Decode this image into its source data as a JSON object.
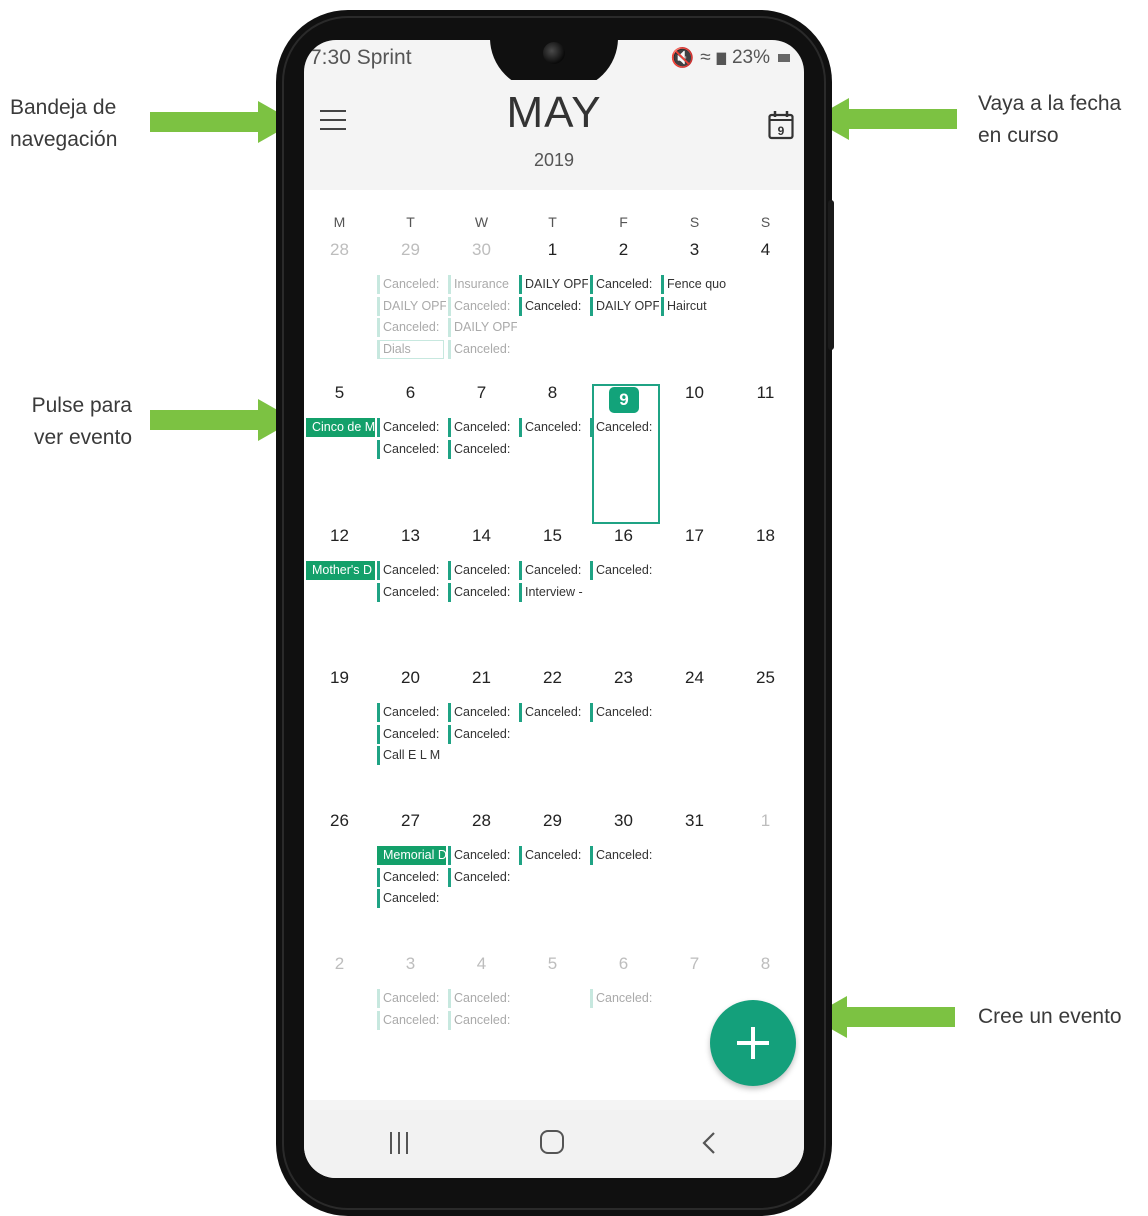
{
  "callouts": {
    "nav_drawer": [
      "Bandeja de",
      "navegación"
    ],
    "go_today": [
      "Vaya a la fecha",
      "en curso"
    ],
    "tap_event": [
      "Pulse para",
      "ver evento"
    ],
    "create_event": "Cree un evento"
  },
  "status": {
    "time_carrier": "7:30 Sprint",
    "battery": "23%"
  },
  "header": {
    "month": "MAY",
    "year": "2019",
    "today_icon_day": "9"
  },
  "weekdays": [
    "M",
    "T",
    "W",
    "T",
    "F",
    "S",
    "S"
  ],
  "weeks": [
    {
      "days": [
        "28",
        "29",
        "30",
        "1",
        "2",
        "3",
        "4"
      ]
    },
    {
      "days": [
        "5",
        "6",
        "7",
        "8",
        "9",
        "10",
        "11"
      ]
    },
    {
      "days": [
        "12",
        "13",
        "14",
        "15",
        "16",
        "17",
        "18"
      ]
    },
    {
      "days": [
        "19",
        "20",
        "21",
        "22",
        "23",
        "24",
        "25"
      ]
    },
    {
      "days": [
        "26",
        "27",
        "28",
        "29",
        "30",
        "31",
        "1"
      ]
    },
    {
      "days": [
        "2",
        "3",
        "4",
        "5",
        "6",
        "7",
        "8"
      ]
    }
  ],
  "events": {
    "w1": {
      "tue": [
        "Canceled:",
        "DAILY OPF",
        "Canceled:",
        "Dials"
      ],
      "wed": [
        "Insurance",
        "Canceled:",
        "DAILY OPF",
        "Canceled:"
      ],
      "thu": [
        "DAILY OPF",
        "Canceled:"
      ],
      "fri": [
        "Canceled:",
        "DAILY OPF"
      ],
      "sat": [
        "Fence quo",
        "Haircut"
      ]
    },
    "w2": {
      "mon": [
        "Cinco de M"
      ],
      "tue": [
        "Canceled:",
        "Canceled:"
      ],
      "wed": [
        "Canceled:",
        "Canceled:"
      ],
      "thu": [
        "Canceled:"
      ],
      "fri": [
        "Canceled:"
      ]
    },
    "w3": {
      "mon": [
        "Mother's D"
      ],
      "tue": [
        "Canceled:",
        "Canceled:"
      ],
      "wed": [
        "Canceled:",
        "Canceled:"
      ],
      "thu": [
        "Canceled:",
        "Interview -"
      ],
      "fri": [
        "Canceled:"
      ]
    },
    "w4": {
      "tue": [
        "Canceled:",
        "Canceled:",
        "Call E L M"
      ],
      "wed": [
        "Canceled:",
        "Canceled:"
      ],
      "thu": [
        "Canceled:"
      ],
      "fri": [
        "Canceled:"
      ]
    },
    "w5": {
      "tue": [
        "Memorial D",
        "Canceled:",
        "Canceled:"
      ],
      "wed": [
        "Canceled:",
        "Canceled:"
      ],
      "thu": [
        "Canceled:"
      ],
      "fri": [
        "Canceled:"
      ]
    },
    "w6": {
      "tue": [
        "Canceled:",
        "Canceled:"
      ],
      "wed": [
        "Canceled:",
        "Canceled:"
      ],
      "fri": [
        "Canceled:"
      ]
    }
  },
  "colors": {
    "accent": "#14a07b",
    "arrow": "#7cc242",
    "holiday": "#13a06a"
  }
}
